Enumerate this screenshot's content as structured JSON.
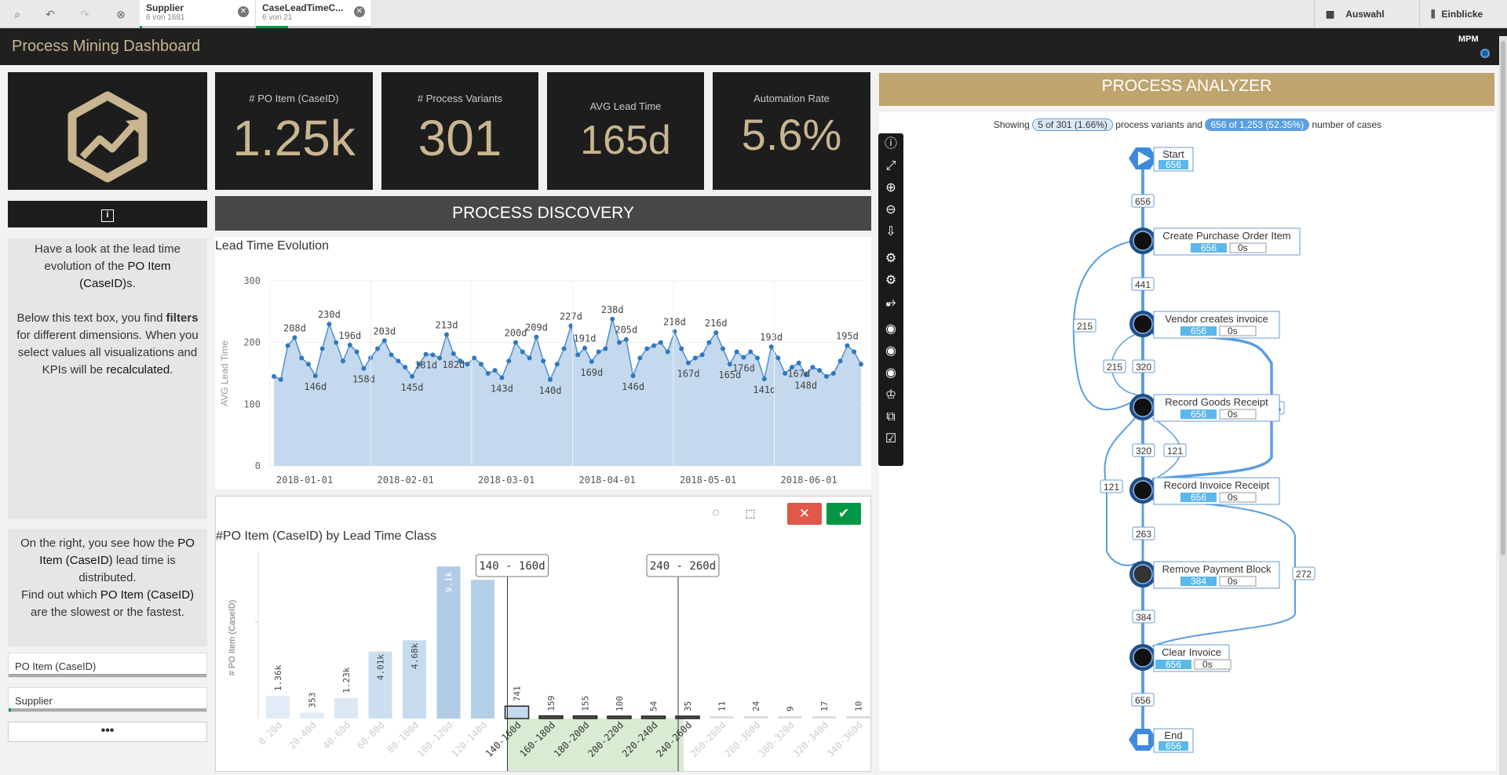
{
  "topbar": {
    "selections": [
      {
        "name": "Supplier",
        "count": "6 von 1681",
        "fill": 0.02
      },
      {
        "name": "CaseLeadTimeC...",
        "count": "6 von 21",
        "fill": 0.6
      }
    ],
    "right_buttons": [
      "Auswahl",
      "Einblicke"
    ]
  },
  "header": {
    "title": "Process Mining Dashboard",
    "logo_text": "MPM"
  },
  "kpis": [
    {
      "label": "# PO Item (CaseID)",
      "value": "1.25k"
    },
    {
      "label": "# Process Variants",
      "value": "301"
    },
    {
      "label": "AVG Lead Time",
      "value": "165d"
    },
    {
      "label": "Automation Rate",
      "value": "5.6%"
    }
  ],
  "info_icon": "info-icon",
  "textbox1": {
    "line1": "Have a look at the lead time evolution of the ",
    "bold1": "PO Item (CaseID)",
    "line1b": "s.",
    "line2": "Below this text box, you find ",
    "bold2": "filters",
    "line2b": " for different dimensions. When you select values all visualizations and KPIs will be ",
    "bold3": "recalculated",
    "line2c": "."
  },
  "textbox2": {
    "p1": "On the right, you see how the ",
    "b1": "PO Item (CaseID)",
    "p1b": " lead time is distributed.",
    "p2": "Find out which ",
    "b2": "PO Item (CaseID)",
    "p2b": " are the slowest or the fastest."
  },
  "filters": [
    {
      "label": "PO Item (CaseID)",
      "fill": 0
    },
    {
      "label": "Supplier",
      "fill": 0.01
    }
  ],
  "more_label": "•••",
  "process_discovery": {
    "title": "PROCESS DISCOVERY"
  },
  "chart_data": [
    {
      "type": "area",
      "title": "Lead Time Evolution",
      "ylabel": "AVG Lead Time",
      "ylim": [
        0,
        300
      ],
      "yticks": [
        0,
        100,
        200,
        300
      ],
      "xticks": [
        "2018-01-01",
        "2018-02-01",
        "2018-03-01",
        "2018-04-01",
        "2018-05-01",
        "2018-06-01"
      ],
      "annotations": [
        {
          "i": 3,
          "label": "208d"
        },
        {
          "i": 6,
          "label": "146d"
        },
        {
          "i": 8,
          "label": "230d"
        },
        {
          "i": 11,
          "label": "196d"
        },
        {
          "i": 13,
          "label": "158d"
        },
        {
          "i": 16,
          "label": "203d"
        },
        {
          "i": 20,
          "label": "145d"
        },
        {
          "i": 22,
          "label": "181d"
        },
        {
          "i": 25,
          "label": "213d"
        },
        {
          "i": 26,
          "label": "182d"
        },
        {
          "i": 33,
          "label": "143d"
        },
        {
          "i": 35,
          "label": "200d"
        },
        {
          "i": 38,
          "label": "209d"
        },
        {
          "i": 40,
          "label": "140d"
        },
        {
          "i": 43,
          "label": "227d"
        },
        {
          "i": 45,
          "label": "191d"
        },
        {
          "i": 46,
          "label": "169d"
        },
        {
          "i": 49,
          "label": "238d"
        },
        {
          "i": 51,
          "label": "205d"
        },
        {
          "i": 52,
          "label": "146d"
        },
        {
          "i": 58,
          "label": "218d"
        },
        {
          "i": 60,
          "label": "167d"
        },
        {
          "i": 64,
          "label": "216d"
        },
        {
          "i": 66,
          "label": "165d"
        },
        {
          "i": 68,
          "label": "176d"
        },
        {
          "i": 71,
          "label": "141d"
        },
        {
          "i": 72,
          "label": "193d"
        },
        {
          "i": 76,
          "label": "167d"
        },
        {
          "i": 77,
          "label": "148d"
        },
        {
          "i": 83,
          "label": "195d"
        }
      ],
      "values": [
        145,
        140,
        195,
        208,
        175,
        165,
        146,
        190,
        230,
        200,
        170,
        196,
        185,
        158,
        175,
        190,
        203,
        180,
        170,
        160,
        145,
        165,
        181,
        180,
        175,
        213,
        182,
        170,
        165,
        175,
        165,
        150,
        155,
        143,
        170,
        200,
        185,
        175,
        209,
        170,
        140,
        165,
        190,
        227,
        180,
        191,
        169,
        185,
        190,
        238,
        200,
        205,
        146,
        175,
        190,
        195,
        200,
        185,
        218,
        190,
        167,
        175,
        180,
        200,
        216,
        190,
        165,
        185,
        176,
        185,
        175,
        141,
        193,
        175,
        150,
        160,
        167,
        148,
        160,
        155,
        145,
        150,
        170,
        195,
        185,
        165
      ]
    },
    {
      "type": "bar",
      "title": "#PO Item (CaseID) by Lead Time Class",
      "ylabel": "# PO Item (CaseID)",
      "categories": [
        "0-20d",
        "20-40d",
        "40-60d",
        "60-80d",
        "80-100d",
        "100-120d",
        "120-140d",
        "140-160d",
        "160-180d",
        "180-200d",
        "200-220d",
        "220-240d",
        "240-260d",
        "260-280d",
        "280-300d",
        "300-320d",
        "320-340d",
        "340-360d"
      ],
      "values": [
        1360,
        353,
        1230,
        4010,
        4680,
        9100,
        8300,
        741,
        159,
        155,
        100,
        54,
        35,
        11,
        24,
        9,
        17,
        10
      ],
      "value_labels": [
        "1.36k",
        "353",
        "1.23k",
        "4.01k",
        "4.68k",
        "9.1k",
        "",
        "741",
        "159",
        "155",
        "100",
        "54",
        "35",
        "11",
        "24",
        "9",
        "17",
        "10"
      ],
      "selection_markers": [
        "140 - 160d",
        "240 - 260d"
      ]
    }
  ],
  "process_analyzer": {
    "title": "PROCESS ANALYZER",
    "showing": "Showing",
    "variants_pill": "5 of 301 (1.66%)",
    "mid_text": "process variants and",
    "cases_pill": "656 of 1,253 (52.35%)",
    "end_text": "number of cases",
    "nodes": [
      {
        "name": "Start",
        "count": "656",
        "time": ""
      },
      {
        "name": "Create Purchase Order Item",
        "count": "656",
        "time": "0s"
      },
      {
        "name": "Vendor creates invoice",
        "count": "656",
        "time": "0s"
      },
      {
        "name": "Record Goods Receipt",
        "count": "656",
        "time": "0s"
      },
      {
        "name": "Record Invoice Receipt",
        "count": "656",
        "time": "0s"
      },
      {
        "name": "Remove Payment Block",
        "count": "384",
        "time": "0s"
      },
      {
        "name": "Clear Invoice",
        "count": "656",
        "time": "0s"
      },
      {
        "name": "End",
        "count": "656",
        "time": ""
      }
    ],
    "edges": [
      "656",
      "441",
      "215",
      "215",
      "320",
      "336",
      "320",
      "121",
      "121",
      "263",
      "272",
      "384",
      "656"
    ]
  },
  "colors": {
    "gold": "#c9b590",
    "dark": "#1d1d1d",
    "accent": "#5aa0e0",
    "green": "#009845",
    "red": "#e0584a"
  }
}
